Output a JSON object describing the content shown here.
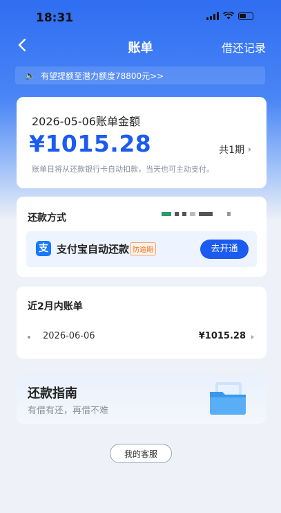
{
  "status_bar": {
    "time": "18:31"
  },
  "nav": {
    "title": "账单",
    "right_link": "借还记录"
  },
  "notice": {
    "text": "有望提额至潜力额度78800元>>"
  },
  "bill": {
    "label": "2026-05-06账单金额",
    "amount": "¥1015.28",
    "period": "共1期",
    "note": "账单日将从还款银行卡自动扣款，当天也可主动支付。"
  },
  "payment": {
    "label": "还款方式",
    "alipay_title": "支付宝自动还款",
    "badge": "防逾期",
    "open_button": "去开通"
  },
  "recent": {
    "title": "近2月内账单",
    "rows": [
      {
        "date": "2026-06-06",
        "amount": "¥1015.28"
      }
    ]
  },
  "guide": {
    "title": "还款指南",
    "subtitle": "有借有还，再借不难"
  },
  "service_button": "我的客服",
  "colors": {
    "accent": "#1b5bf0",
    "alipay": "#1677ff",
    "badge": "#e8742a"
  }
}
